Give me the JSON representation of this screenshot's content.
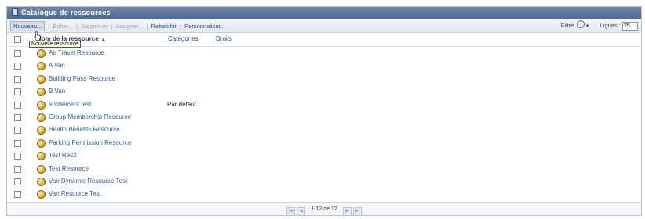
{
  "title": "Catalogue de ressources",
  "toolbar": {
    "new_label": "Nouveau...",
    "edit_label": "Éditer...",
    "delete_label": "Supprimer",
    "assign_label": "Assigner...",
    "refresh_label": "Rafraîchir",
    "customize_label": "Personnaliser...",
    "filter_label": "Filtre",
    "rows_label": "Lignes :",
    "rows_value": "25"
  },
  "tooltip": "Nouvelle ressource",
  "columns": {
    "name": "Nom de la ressource",
    "categories": "Catégories",
    "rights": "Droits"
  },
  "rows": [
    {
      "name": "Air Travel Resource",
      "category": ""
    },
    {
      "name": "A Van",
      "category": ""
    },
    {
      "name": "Building Pass Resource",
      "category": ""
    },
    {
      "name": "B Van",
      "category": ""
    },
    {
      "name": "entitlement test",
      "category": "Par défaut"
    },
    {
      "name": "Group Membership Resource",
      "category": ""
    },
    {
      "name": "Health Benefits Resource",
      "category": ""
    },
    {
      "name": "Parking Permission Resource",
      "category": ""
    },
    {
      "name": "Test Res2",
      "category": ""
    },
    {
      "name": "Test Resource",
      "category": ""
    },
    {
      "name": "Van Dynamic Resource Test",
      "category": ""
    },
    {
      "name": "Van Resource Test",
      "category": ""
    }
  ],
  "pager": {
    "label": "1-12 de 12"
  }
}
